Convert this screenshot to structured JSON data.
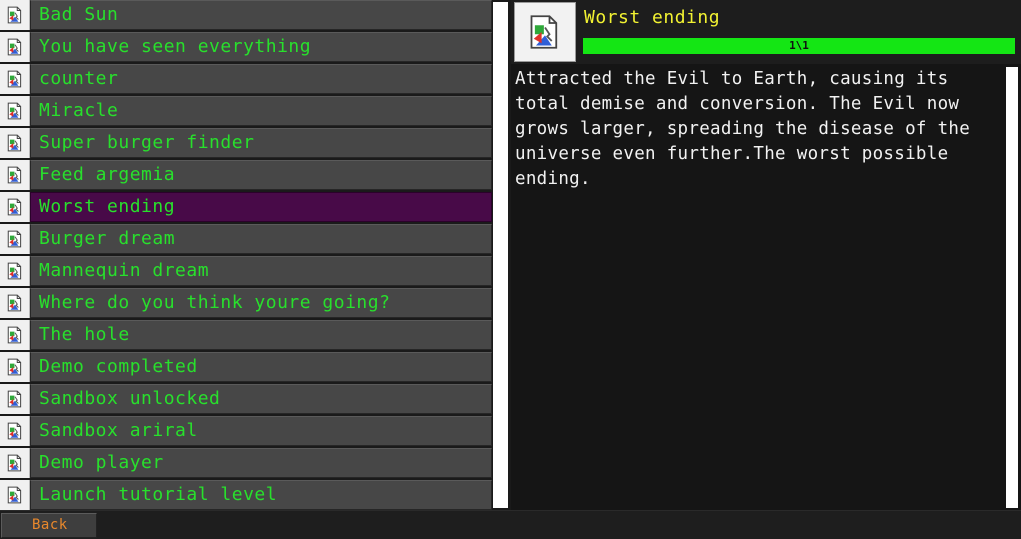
{
  "achievements": [
    {
      "label": "Bad Sun",
      "selected": false,
      "icon": "broken-image-icon"
    },
    {
      "label": "You have seen everything",
      "selected": false,
      "icon": "broken-image-icon"
    },
    {
      "label": "counter",
      "selected": false,
      "icon": "broken-image-icon"
    },
    {
      "label": "Miracle",
      "selected": false,
      "icon": "broken-image-icon"
    },
    {
      "label": "Super burger finder",
      "selected": false,
      "icon": "broken-image-icon"
    },
    {
      "label": "Feed argemia",
      "selected": false,
      "icon": "broken-image-icon"
    },
    {
      "label": "Worst ending",
      "selected": true,
      "icon": "broken-image-icon"
    },
    {
      "label": "Burger dream",
      "selected": false,
      "icon": "broken-image-icon"
    },
    {
      "label": "Mannequin dream",
      "selected": false,
      "icon": "broken-image-icon"
    },
    {
      "label": "Where do you think youre going?",
      "selected": false,
      "icon": "broken-image-icon"
    },
    {
      "label": "The hole",
      "selected": false,
      "icon": "broken-image-icon"
    },
    {
      "label": "Demo completed",
      "selected": false,
      "icon": "broken-image-icon"
    },
    {
      "label": "Sandbox unlocked",
      "selected": false,
      "icon": "broken-image-icon"
    },
    {
      "label": "Sandbox ariral",
      "selected": false,
      "icon": "broken-image-icon"
    },
    {
      "label": "Demo player",
      "selected": false,
      "icon": "broken-image-icon"
    },
    {
      "label": "Launch tutorial level",
      "selected": false,
      "icon": "broken-image-icon"
    }
  ],
  "detail": {
    "title": "Worst ending",
    "progress_text": "1\\1",
    "progress_fraction": 1.0,
    "description": "Attracted the Evil to Earth, causing its total demise and conversion. The Evil now grows larger, spreading the disease of the universe even further.The worst possible ending.",
    "icon": "broken-image-icon"
  },
  "footer": {
    "back_label": "Back"
  },
  "colors": {
    "item_text": "#28e02c",
    "title_text": "#f2f232",
    "selected_bg": "#480a48",
    "progress_fill": "#14e614",
    "back_text": "#e8882c"
  }
}
